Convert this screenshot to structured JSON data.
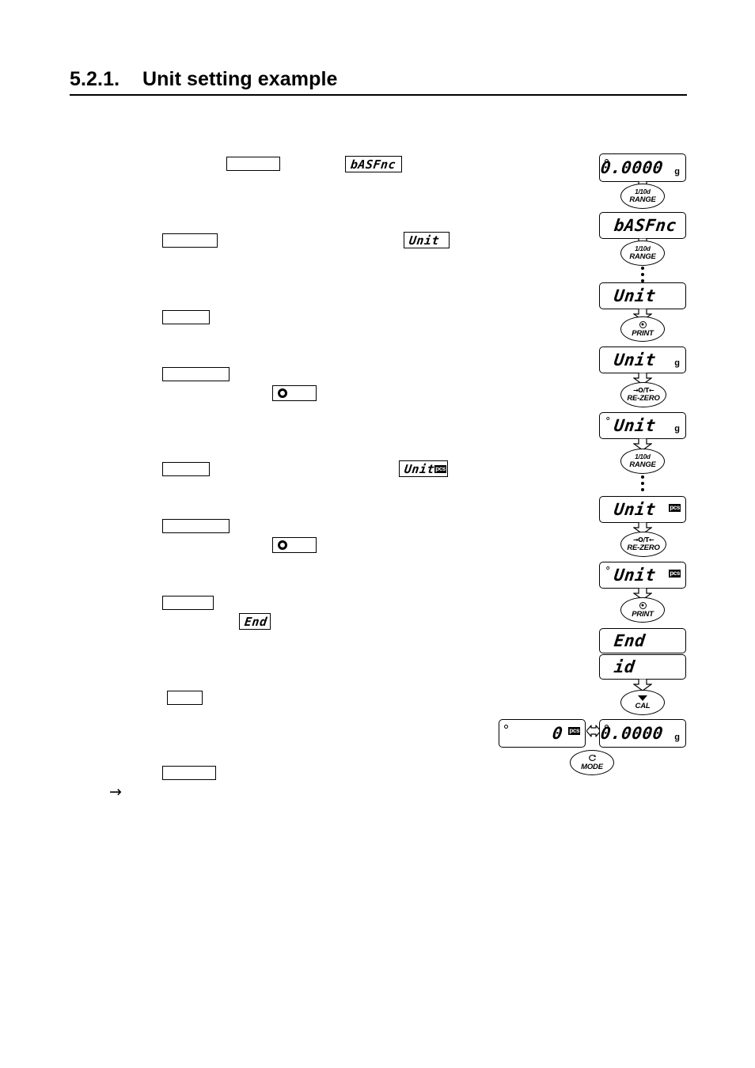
{
  "heading": {
    "number": "5.2.1.",
    "title": "Unit setting example"
  },
  "body_steps": [
    {
      "key_label": "",
      "display": "bASFnc"
    },
    {
      "key_label": "",
      "display": "Unit"
    },
    {
      "key_label": "",
      "display": ""
    },
    {
      "key_label": "",
      "display": "○"
    },
    {
      "key_label": "",
      "display": "Unit",
      "unit": "pcs"
    },
    {
      "key_label": "",
      "display": "○"
    },
    {
      "key_label": "",
      "display": "End"
    },
    {
      "key_label": "",
      "display": ""
    },
    {
      "key_label": "",
      "display": ""
    }
  ],
  "continuation_arrow": "→",
  "flow": {
    "displays": {
      "start": {
        "value": "0.0000",
        "unit": "g",
        "stability": "○"
      },
      "basfnc": {
        "value": "bASFnc",
        "unit": "",
        "stability": ""
      },
      "unit1": {
        "value": "Unit",
        "unit": "",
        "stability": ""
      },
      "unit_g": {
        "value": "Unit",
        "unit": "g",
        "stability": ""
      },
      "unit_g_sel": {
        "value": "Unit",
        "unit": "g",
        "stability": "°"
      },
      "unit_pcs": {
        "value": "Unit",
        "unit": "pcs",
        "stability": ""
      },
      "unit_pcs_sel": {
        "value": "Unit",
        "unit": "pcs",
        "stability": "°"
      },
      "end": {
        "value": "End",
        "unit": "",
        "stability": ""
      },
      "id": {
        "value": "id",
        "unit": "",
        "stability": ""
      },
      "result_pcs": {
        "value": "0",
        "unit": "pcs",
        "stability": "○"
      },
      "result_g": {
        "value": "0.0000",
        "unit": "g",
        "stability": "○"
      }
    },
    "keys": {
      "range": {
        "top": "1/10d",
        "label": "RANGE"
      },
      "print": {
        "top": "print-icon",
        "label": "PRINT"
      },
      "rezero": {
        "top": "→O/T←",
        "label": "RE-ZERO"
      },
      "cal": {
        "top": "triangle-down-icon",
        "label": "CAL"
      },
      "mode": {
        "top": "cycle-icon",
        "label": "MODE"
      }
    }
  },
  "colors": {
    "ink": "#000000",
    "page": "#ffffff"
  }
}
